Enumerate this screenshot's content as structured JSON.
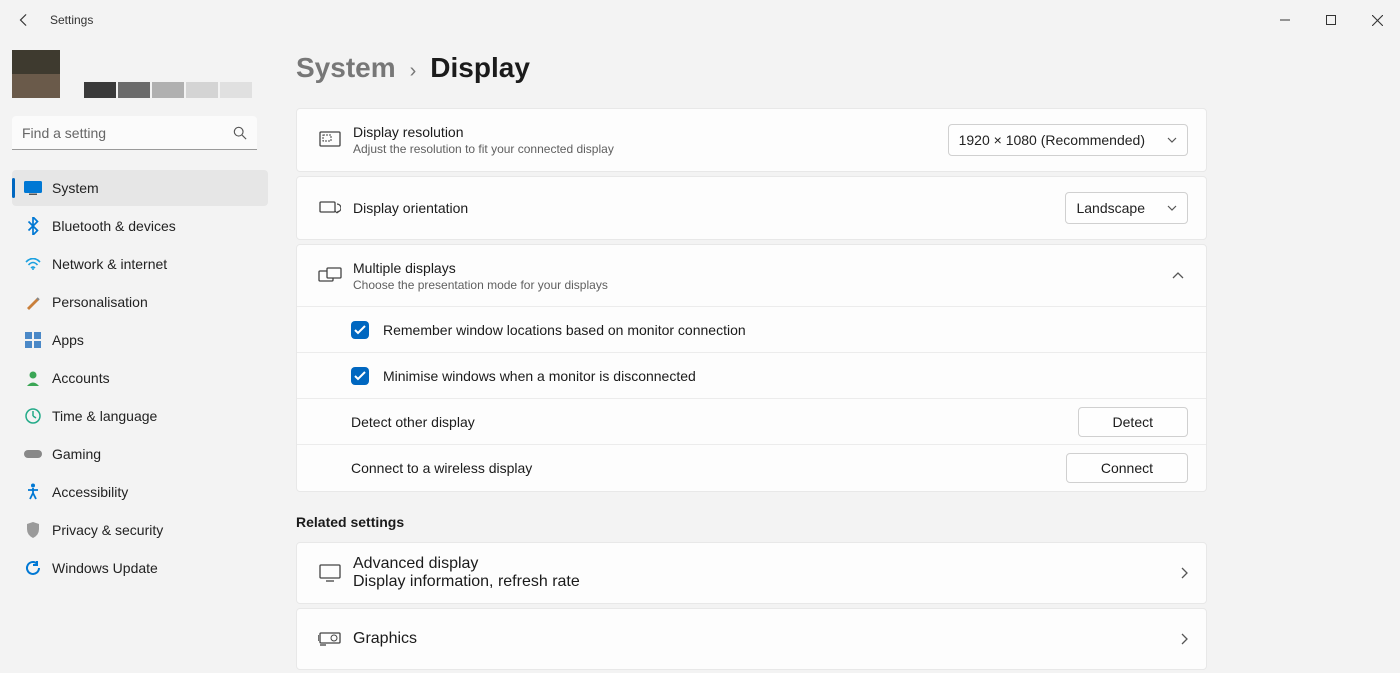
{
  "window": {
    "title": "Settings"
  },
  "search": {
    "placeholder": "Find a setting"
  },
  "sidebar": {
    "items": [
      {
        "label": "System"
      },
      {
        "label": "Bluetooth & devices"
      },
      {
        "label": "Network & internet"
      },
      {
        "label": "Personalisation"
      },
      {
        "label": "Apps"
      },
      {
        "label": "Accounts"
      },
      {
        "label": "Time & language"
      },
      {
        "label": "Gaming"
      },
      {
        "label": "Accessibility"
      },
      {
        "label": "Privacy & security"
      },
      {
        "label": "Windows Update"
      }
    ]
  },
  "breadcrumb": {
    "parent": "System",
    "current": "Display"
  },
  "rows": {
    "resolution": {
      "label": "Display resolution",
      "sub": "Adjust the resolution to fit your connected display",
      "value": "1920 × 1080 (Recommended)"
    },
    "orientation": {
      "label": "Display orientation",
      "value": "Landscape"
    },
    "multiple": {
      "label": "Multiple displays",
      "sub": "Choose the presentation mode for your displays",
      "remember": "Remember window locations based on monitor connection",
      "minimise": "Minimise windows when a monitor is disconnected",
      "detect_label": "Detect other display",
      "detect_button": "Detect",
      "connect_label": "Connect to a wireless display",
      "connect_button": "Connect"
    }
  },
  "related": {
    "heading": "Related settings",
    "advanced": {
      "label": "Advanced display",
      "sub": "Display information, refresh rate"
    },
    "graphics": {
      "label": "Graphics"
    }
  }
}
